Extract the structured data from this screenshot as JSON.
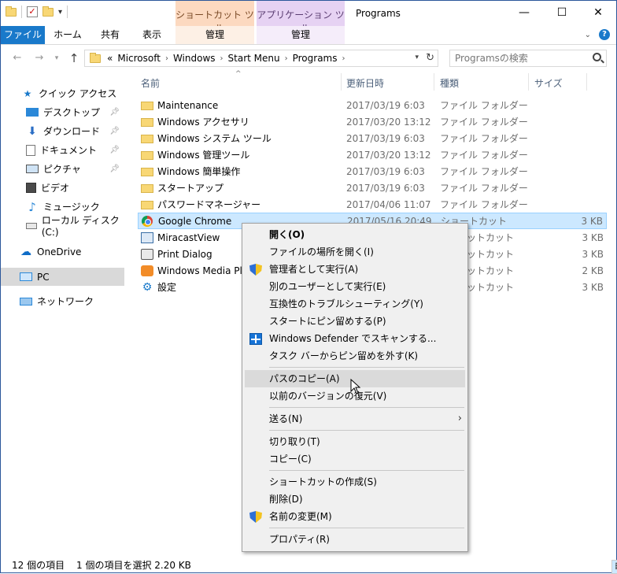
{
  "titlebar": {
    "title": "Programs",
    "contextual_tabs": {
      "shortcut_tools": "ショートカット ツール",
      "application_tools": "アプリケーション ツール"
    },
    "controls": {
      "minimize": "—",
      "maximize": "☐",
      "close": "✕"
    }
  },
  "ribbon": {
    "tabs": {
      "file": "ファイル",
      "home": "ホーム",
      "share": "共有",
      "view": "表示",
      "manage1": "管理",
      "manage2": "管理"
    },
    "help": "?"
  },
  "address": {
    "overflow": "«",
    "crumbs": [
      "Microsoft",
      "Windows",
      "Start Menu",
      "Programs"
    ],
    "search_placeholder": "Programsの検索"
  },
  "nav": {
    "quick_access": "クイック アクセス",
    "pinned": [
      "デスクトップ",
      "ダウンロード",
      "ドキュメント",
      "ピクチャ"
    ],
    "libs": [
      "ビデオ",
      "ミュージック",
      "ローカル ディスク (C:)"
    ],
    "onedrive": "OneDrive",
    "pc": "PC",
    "network": "ネットワーク"
  },
  "columns": {
    "name": "名前",
    "date": "更新日時",
    "type": "種類",
    "size": "サイズ"
  },
  "files": [
    {
      "name": "Maintenance",
      "date": "2017/03/19 6:03",
      "type": "ファイル フォルダー",
      "size": "",
      "icon": "folder-icon"
    },
    {
      "name": "Windows アクセサリ",
      "date": "2017/03/20 13:12",
      "type": "ファイル フォルダー",
      "size": "",
      "icon": "folder-icon"
    },
    {
      "name": "Windows システム ツール",
      "date": "2017/03/19 6:03",
      "type": "ファイル フォルダー",
      "size": "",
      "icon": "folder-icon"
    },
    {
      "name": "Windows 管理ツール",
      "date": "2017/03/20 13:12",
      "type": "ファイル フォルダー",
      "size": "",
      "icon": "folder-icon"
    },
    {
      "name": "Windows 簡単操作",
      "date": "2017/03/19 6:03",
      "type": "ファイル フォルダー",
      "size": "",
      "icon": "folder-icon"
    },
    {
      "name": "スタートアップ",
      "date": "2017/03/19 6:03",
      "type": "ファイル フォルダー",
      "size": "",
      "icon": "folder-icon"
    },
    {
      "name": "パスワードマネージャー",
      "date": "2017/04/06 11:07",
      "type": "ファイル フォルダー",
      "size": "",
      "icon": "folder-icon"
    },
    {
      "name": "Google Chrome",
      "date": "2017/05/16 20:49",
      "type": "ショートカット",
      "size": "3 KB",
      "icon": "chrome-icon"
    },
    {
      "name": "MiracastView",
      "date": "",
      "type": "ットカット",
      "size": "3 KB",
      "icon": "miracast-icon"
    },
    {
      "name": "Print Dialog",
      "date": "",
      "type": "ットカット",
      "size": "3 KB",
      "icon": "printer-icon"
    },
    {
      "name": "Windows Media Play",
      "date": "",
      "type": "ットカット",
      "size": "2 KB",
      "icon": "media-player-icon"
    },
    {
      "name": "設定",
      "date": "",
      "type": "ットカット",
      "size": "3 KB",
      "icon": "settings-gear-icon"
    }
  ],
  "menu": {
    "open": "開く(O)",
    "open_location": "ファイルの場所を開く(I)",
    "run_as_admin": "管理者として実行(A)",
    "run_as_other": "別のユーザーとして実行(E)",
    "troubleshoot": "互換性のトラブルシューティング(Y)",
    "pin_start": "スタートにピン留めする(P)",
    "defender": "Windows Defender でスキャンする...",
    "unpin_taskbar": "タスク バーからピン留めを外す(K)",
    "copy_path": "パスのコピー(A)",
    "restore_prev": "以前のバージョンの復元(V)",
    "send_to": "送る(N)",
    "cut": "切り取り(T)",
    "copy": "コピー(C)",
    "create_shortcut": "ショートカットの作成(S)",
    "delete": "削除(D)",
    "rename": "名前の変更(M)",
    "properties": "プロパティ(R)"
  },
  "status": {
    "count": "12 個の項目",
    "selection": "1 個の項目を選択  2.20 KB"
  },
  "colors": {
    "accent": "#1979ca",
    "selection": "#cce8ff",
    "menu_bg": "#f0f0f0",
    "hover": "#dadada"
  }
}
